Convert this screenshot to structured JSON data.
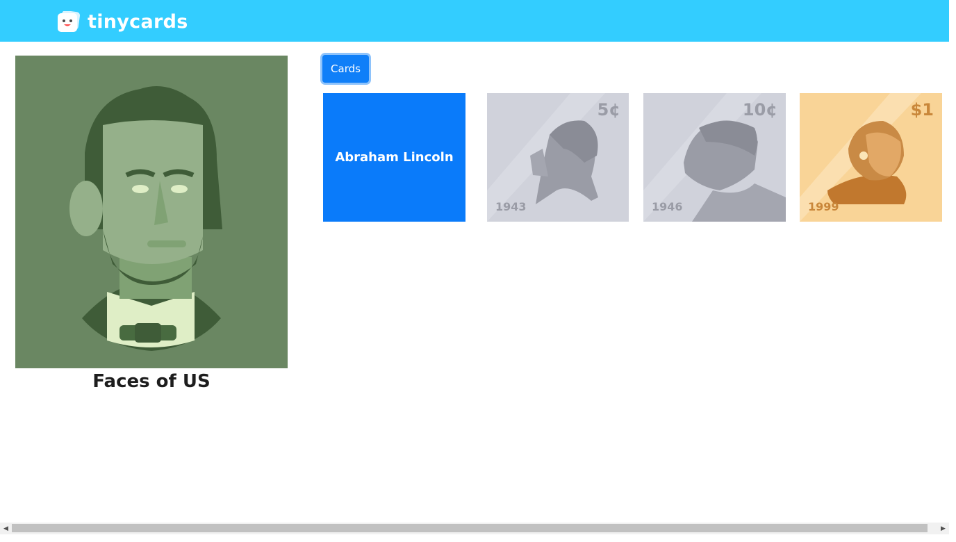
{
  "header": {
    "logo_text": "tinycards",
    "background_color": "#33cdff"
  },
  "deck": {
    "title": "Faces of US",
    "image_icon": "abraham-lincoln-portrait"
  },
  "toolbar": {
    "cards_label": "Cards",
    "accent_color": "#0f7ff8"
  },
  "cards": [
    {
      "label": "Abraham Lincoln"
    },
    {
      "value": "5¢",
      "year": "1943"
    },
    {
      "value": "10¢",
      "year": "1946"
    },
    {
      "value": "$1",
      "year": "1999"
    }
  ],
  "scrollbar": {
    "left_arrow": "◀",
    "right_arrow": "▶"
  }
}
